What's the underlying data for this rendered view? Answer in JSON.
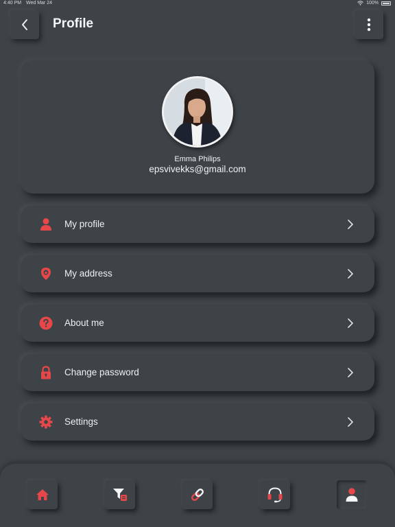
{
  "status_bar": {
    "time": "4:40 PM",
    "date": "Wed Mar 24",
    "battery": "100%"
  },
  "header": {
    "title": "Profile",
    "back_icon": "chevron-left-icon",
    "menu_icon": "more-vertical-icon"
  },
  "profile": {
    "name": "Emma Philips",
    "email": "epsvivekks@gmail.com"
  },
  "menu": {
    "items": [
      {
        "label": "My profile",
        "icon": "person-icon"
      },
      {
        "label": "My address",
        "icon": "location-pin-icon"
      },
      {
        "label": "About me",
        "icon": "question-icon"
      },
      {
        "label": "Change password",
        "icon": "lock-icon"
      },
      {
        "label": "Settings",
        "icon": "gear-icon"
      }
    ]
  },
  "bottom_nav": {
    "items": [
      {
        "icon": "home-icon",
        "active": false
      },
      {
        "icon": "filter-icon",
        "active": false
      },
      {
        "icon": "link-icon",
        "active": false
      },
      {
        "icon": "headset-icon",
        "active": false
      },
      {
        "icon": "profile-icon",
        "active": true
      }
    ]
  },
  "colors": {
    "background": "#3d4347",
    "accent": "#e8474a",
    "text": "#eef0f1"
  }
}
